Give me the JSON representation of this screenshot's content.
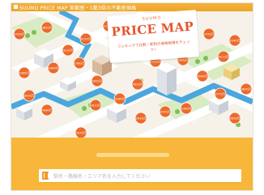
{
  "window": {
    "title_bar_text": "SUUMO PRICE MAP 首都圏・1都3県の不動産価格"
  },
  "title_card": {
    "brand": "SUUMO",
    "title": "PRICE MAP",
    "subtitle": "ランキングで比較・駅別の価格相場をチェック！"
  },
  "search": {
    "placeholder": "駅名・路線名・エリア名を入力してください"
  },
  "map": {
    "price_markers": [
      "2498万",
      "3850万",
      "3230万",
      "4120万",
      "2980万",
      "3340万",
      "1980万",
      "2650万",
      "4500万",
      "3120万",
      "2890万",
      "3760万",
      "2240万",
      "4210万",
      "3080万",
      "2770万",
      "3690万",
      "2360万",
      "3950万",
      "2540万",
      "3180万",
      "2810万",
      "4380万",
      "3020万",
      "2610万",
      "3470万",
      "2190m"
    ]
  },
  "colors": {
    "accent": "#f8b63a",
    "marker": "#ec6a2b",
    "road": "#4aa7de",
    "park": "#cfe6b5",
    "ground": "#f6f2ea"
  }
}
